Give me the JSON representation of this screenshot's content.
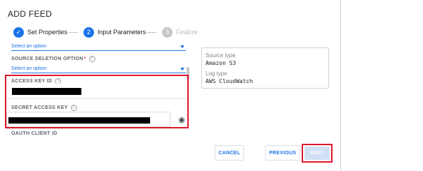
{
  "dialog": {
    "title": "ADD FEED"
  },
  "stepper": {
    "steps": [
      {
        "index": "✓",
        "label": "Set Properties",
        "state": "done"
      },
      {
        "index": "2",
        "label": "Input Parameters",
        "state": "active"
      },
      {
        "index": "3",
        "label": "Finalize",
        "state": "upcoming"
      }
    ]
  },
  "form": {
    "top_select": {
      "value": "Select an option"
    },
    "source_deletion": {
      "label": "SOURCE DELETION OPTION",
      "required_mark": "*",
      "value": "Select an option"
    },
    "access_key": {
      "label": "ACCESS KEY ID"
    },
    "secret_key": {
      "label": "SECRET ACCESS KEY"
    },
    "oauth": {
      "label": "OAUTH CLIENT ID"
    }
  },
  "info": {
    "source_type_label": "Source type",
    "source_type_value": "Amazon S3",
    "log_type_label": "Log type",
    "log_type_value": "AWS CloudWatch"
  },
  "footer": {
    "cancel": "CANCEL",
    "previous": "PREVIOUS",
    "next": "NEXT"
  },
  "colors": {
    "accent": "#1a73e8",
    "highlight": "#e0142b",
    "disabled_button": "#d1dff5"
  },
  "icons": {
    "help": "help-circle-icon",
    "visibility": "eye-icon",
    "dropdown": "caret-down-icon",
    "done_step": "check-icon"
  }
}
